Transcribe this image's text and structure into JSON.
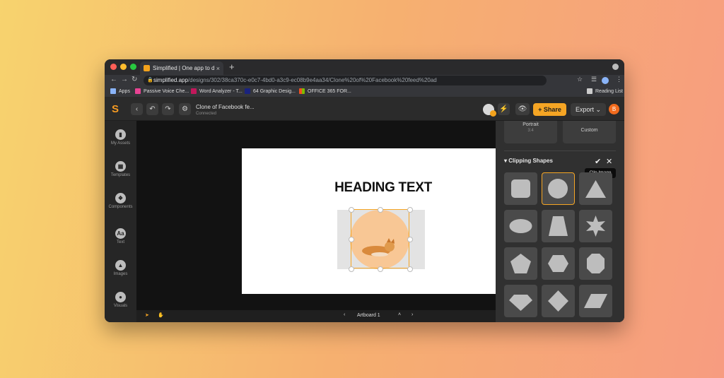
{
  "browser": {
    "tab_title": "Simplified | One app to design...",
    "tab_close": "×",
    "new_tab": "+",
    "url_domain": "simplified.app",
    "url_path": "/designs/302/38ca370c-e0c7-4bd0-a3c9-ec08b9e4aa34/Clone%20of%20Facebook%20feed%20ad",
    "bookmarks": [
      "Apps",
      "Passive Voice Che...",
      "Word Analyzer - T...",
      "64 Graphic Desig...",
      "OFFICE 365 FOR..."
    ],
    "reading_list": "Reading List"
  },
  "app": {
    "doc_title": "Clone of Facebook fe...",
    "doc_status": "Connected",
    "share_label": "Share",
    "export_label": "Export",
    "user_initial": "B"
  },
  "sidebar": {
    "items": [
      {
        "label": "My Assets",
        "icon": "folder-icon"
      },
      {
        "label": "Templates",
        "icon": "templates-icon"
      },
      {
        "label": "Components",
        "icon": "components-icon"
      },
      {
        "label": "Text",
        "icon": "text-icon",
        "glyph": "Aa"
      },
      {
        "label": "Images",
        "icon": "image-icon"
      },
      {
        "label": "Visuals",
        "icon": "visuals-icon"
      }
    ]
  },
  "canvas": {
    "heading": "HEADING TEXT",
    "artboard_label": "Artboard 1"
  },
  "panel": {
    "portrait_label": "Portrait",
    "portrait_ratio": "3:4",
    "custom_label": "Custom",
    "section_title": "Clipping Shapes",
    "tooltip": "Clip Image"
  },
  "colors": {
    "accent": "#f5a524",
    "background_start": "#f7d36e",
    "background_end": "#f79c80"
  }
}
